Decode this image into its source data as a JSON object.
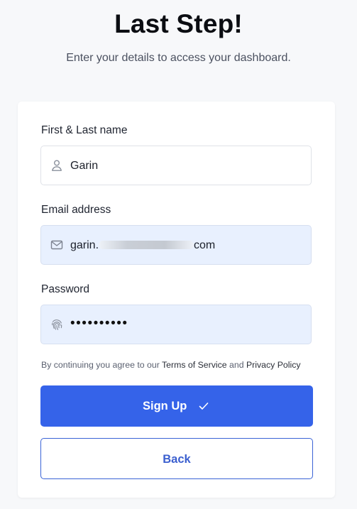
{
  "header": {
    "title": "Last Step!",
    "subtitle": "Enter your details to access your dashboard."
  },
  "form": {
    "name": {
      "label": "First & Last name",
      "value": "Garin",
      "icon": "user-icon"
    },
    "email": {
      "label": "Email address",
      "value_prefix": "garin.",
      "value_suffix": "com",
      "icon": "mail-icon"
    },
    "password": {
      "label": "Password",
      "value": "••••••••••",
      "icon": "fingerprint-icon"
    },
    "terms": {
      "prefix": "By continuing you agree to our",
      "terms_link": "Terms of Service",
      "and": "and",
      "privacy_link": "Privacy Policy"
    },
    "submit_label": "Sign Up",
    "back_label": "Back"
  },
  "colors": {
    "primary": "#3563e9",
    "autofill_bg": "#e8f0fe",
    "page_bg": "#f7f8fa"
  }
}
